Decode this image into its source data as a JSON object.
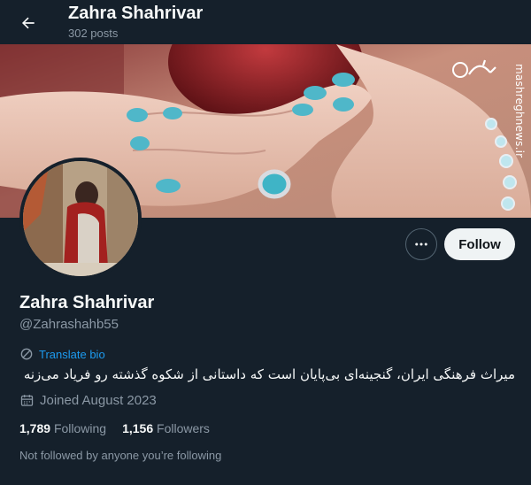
{
  "header": {
    "title": "Zahra Shahrivar",
    "post_count": "302 posts"
  },
  "banner": {
    "watermark_text": "mashreghnews.ir",
    "watermark_logo_text": "مشرق"
  },
  "profile": {
    "name": "Zahra Shahrivar",
    "handle": "@Zahrashahb55",
    "translate_label": "Translate bio",
    "bio": "میراث فرهنگی ایران، گنجینه‌ای بی‌پایان است که داستانی از شکوه گذشته رو فریاد می‌زنه",
    "joined": "Joined August 2023",
    "following_count": "1,789",
    "following_label": "Following",
    "followers_count": "1,156",
    "followers_label": "Followers",
    "not_followed": "Not followed by anyone you’re following"
  },
  "actions": {
    "follow_label": "Follow"
  },
  "icons": {
    "back": "arrow-left-icon",
    "more": "more-horizontal-icon",
    "translate": "globe-translate-icon",
    "calendar": "calendar-icon"
  },
  "colors": {
    "background": "#15202b",
    "accent": "#1d9bf0",
    "secondary_text": "#8b98a5",
    "follow_bg": "#eff3f4"
  }
}
